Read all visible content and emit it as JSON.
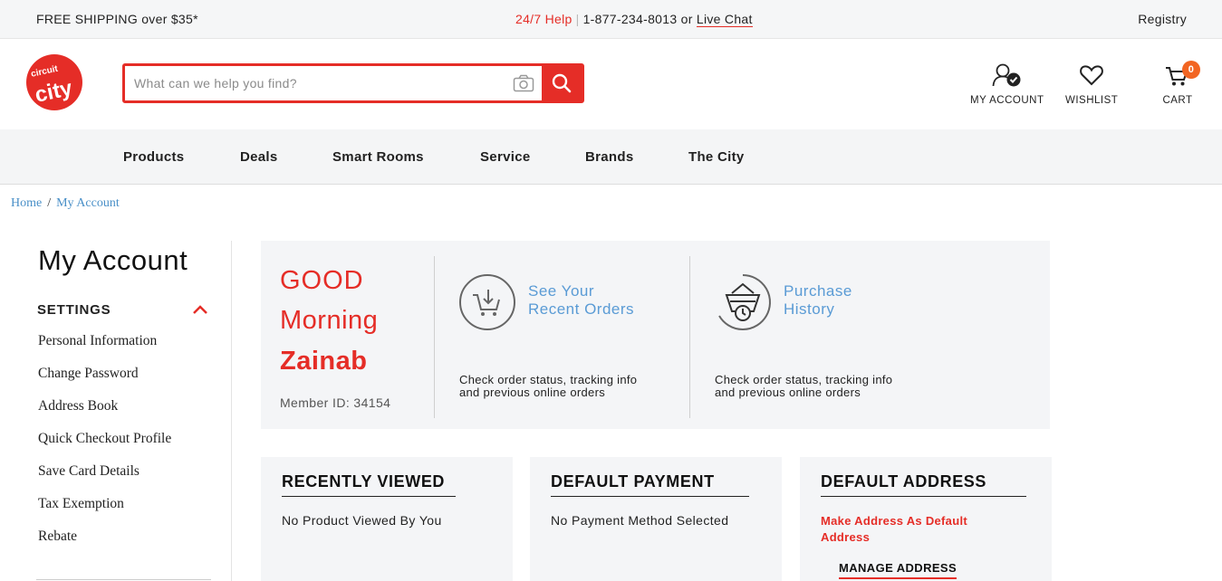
{
  "topbar": {
    "shipping": "FREE SHIPPING over $35*",
    "help_label": "24/7 Help",
    "phone_text": "1-877-234-8013 or",
    "live_chat": "Live Chat",
    "registry": "Registry"
  },
  "header": {
    "logo_text": "city",
    "search_placeholder": "What can we help you find?",
    "my_account": "MY ACCOUNT",
    "wishlist": "WISHLIST",
    "cart": "CART",
    "cart_count": "0"
  },
  "nav": {
    "items": [
      "Products",
      "Deals",
      "Smart Rooms",
      "Service",
      "Brands",
      "The City"
    ]
  },
  "breadcrumb": {
    "home": "Home",
    "separator": "/",
    "current": "My Account"
  },
  "sidebar": {
    "title": "My Account",
    "section": "SETTINGS",
    "links": [
      "Personal Information",
      "Change Password",
      "Address Book",
      "Quick Checkout Profile",
      "Save Card Details",
      "Tax Exemption",
      "Rebate"
    ]
  },
  "greeting": {
    "line1": "GOOD",
    "line2": "Morning",
    "name": "Zainab",
    "member_id": "Member ID: 34154"
  },
  "features": [
    {
      "title_line1": "See Your",
      "title_line2": "Recent Orders",
      "desc_line1": "Check order status, tracking info",
      "desc_line2": "and previous online orders",
      "icon": "cart-download-icon"
    },
    {
      "title_line1": "Purchase",
      "title_line2": "History",
      "desc_line1": "Check order status, tracking info",
      "desc_line2": "and previous online orders",
      "icon": "basket-clock-icon"
    }
  ],
  "cards": {
    "recently_viewed": {
      "title": "RECENTLY VIEWED",
      "text": "No Product Viewed By You"
    },
    "default_payment": {
      "title": "DEFAULT PAYMENT",
      "text": "No Payment Method Selected"
    },
    "default_address": {
      "title": "DEFAULT ADDRESS",
      "action": "Make Address As Default Address",
      "manage": "MANAGE ADDRESS"
    }
  },
  "colors": {
    "brand_red": "#e52d27",
    "link_blue": "#5a9bd5",
    "badge_orange": "#f26522",
    "panel_bg": "#f4f5f7"
  }
}
